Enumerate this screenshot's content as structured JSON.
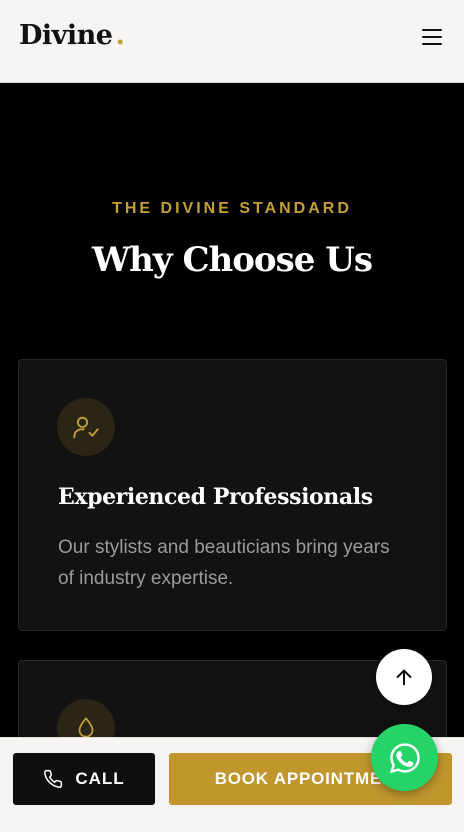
{
  "header": {
    "logo_text": "Divine",
    "logo_dot": ".",
    "menu_icon": "hamburger-menu-icon"
  },
  "section": {
    "eyebrow": "THE DIVINE STANDARD",
    "title": "Why Choose Us"
  },
  "cards": [
    {
      "icon": "user-check-icon",
      "title": "Experienced Professionals",
      "text": "Our stylists and beauticians bring years of industry expertise."
    },
    {
      "icon": "droplet-icon"
    }
  ],
  "scroll_top": {
    "icon": "arrow-up-icon"
  },
  "bottom_bar": {
    "call_label": "CALL",
    "call_icon": "phone-icon",
    "book_label": "BOOK APPOINTMENT"
  },
  "whatsapp": {
    "icon": "whatsapp-icon"
  },
  "colors": {
    "accent_gold": "#c4a034",
    "button_gold": "#c1972d",
    "whatsapp_green": "#25d366",
    "background": "#000000",
    "card_bg": "#121212"
  }
}
